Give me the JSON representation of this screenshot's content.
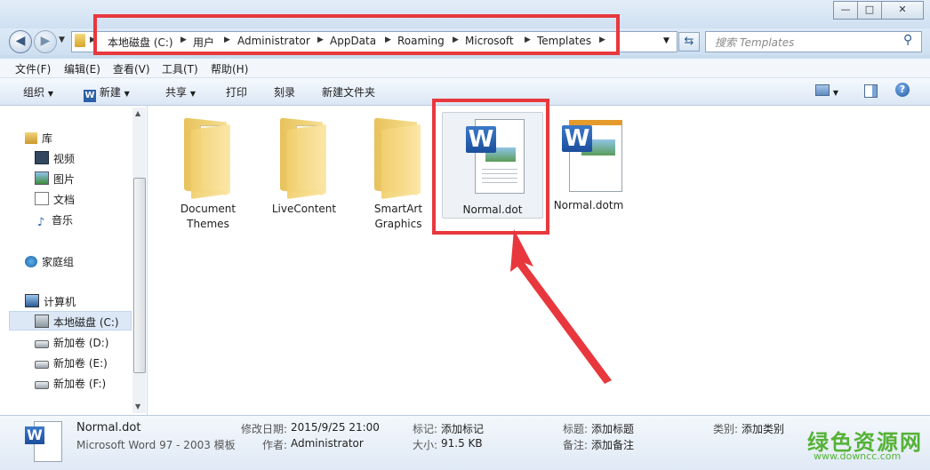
{
  "window": {
    "minimize": "—",
    "maximize": "□",
    "close": "✕"
  },
  "address": {
    "crumbs": [
      "本地磁盘 (C:)",
      "用户",
      "Administrator",
      "AppData",
      "Roaming",
      "Microsoft",
      "Templates"
    ],
    "search_placeholder": "搜索 Templates"
  },
  "menubar": [
    "文件(F)",
    "编辑(E)",
    "查看(V)",
    "工具(T)",
    "帮助(H)"
  ],
  "toolbar": {
    "organize": "组织",
    "new": "新建",
    "share": "共享",
    "print": "打印",
    "burn": "刻录",
    "new_folder": "新建文件夹"
  },
  "nav": {
    "library": "库",
    "videos": "视频",
    "pictures": "图片",
    "documents": "文档",
    "music": "音乐",
    "homegroup": "家庭组",
    "computer": "计算机",
    "drive_c": "本地磁盘 (C:)",
    "drive_d": "新加卷 (D:)",
    "drive_e": "新加卷 (E:)",
    "drive_f": "新加卷 (F:)"
  },
  "files": [
    {
      "line1": "Document",
      "line2": "Themes"
    },
    {
      "line1": "LiveContent",
      "line2": ""
    },
    {
      "line1": "SmartArt",
      "line2": "Graphics"
    },
    {
      "line1": "Normal.dot",
      "line2": ""
    },
    {
      "line1": "Normal.dotm",
      "line2": ""
    }
  ],
  "details": {
    "name": "Normal.dot",
    "type": "Microsoft Word 97 - 2003 模板",
    "modified_label": "修改日期:",
    "modified": "2015/9/25 21:00",
    "author_label": "作者:",
    "author": "Administrator",
    "tags_label": "标记:",
    "tags": "添加标记",
    "size_label": "大小:",
    "size": "91.5 KB",
    "title_label": "标题:",
    "title": "添加标题",
    "comments_label": "备注:",
    "comments": "添加备注",
    "category_label": "类别:",
    "category": "添加类别"
  },
  "watermark": {
    "text": "绿色资源网",
    "url": "www.downcc.com"
  },
  "colors": {
    "highlight": "#e8383d",
    "selection": "#dce8f6"
  }
}
